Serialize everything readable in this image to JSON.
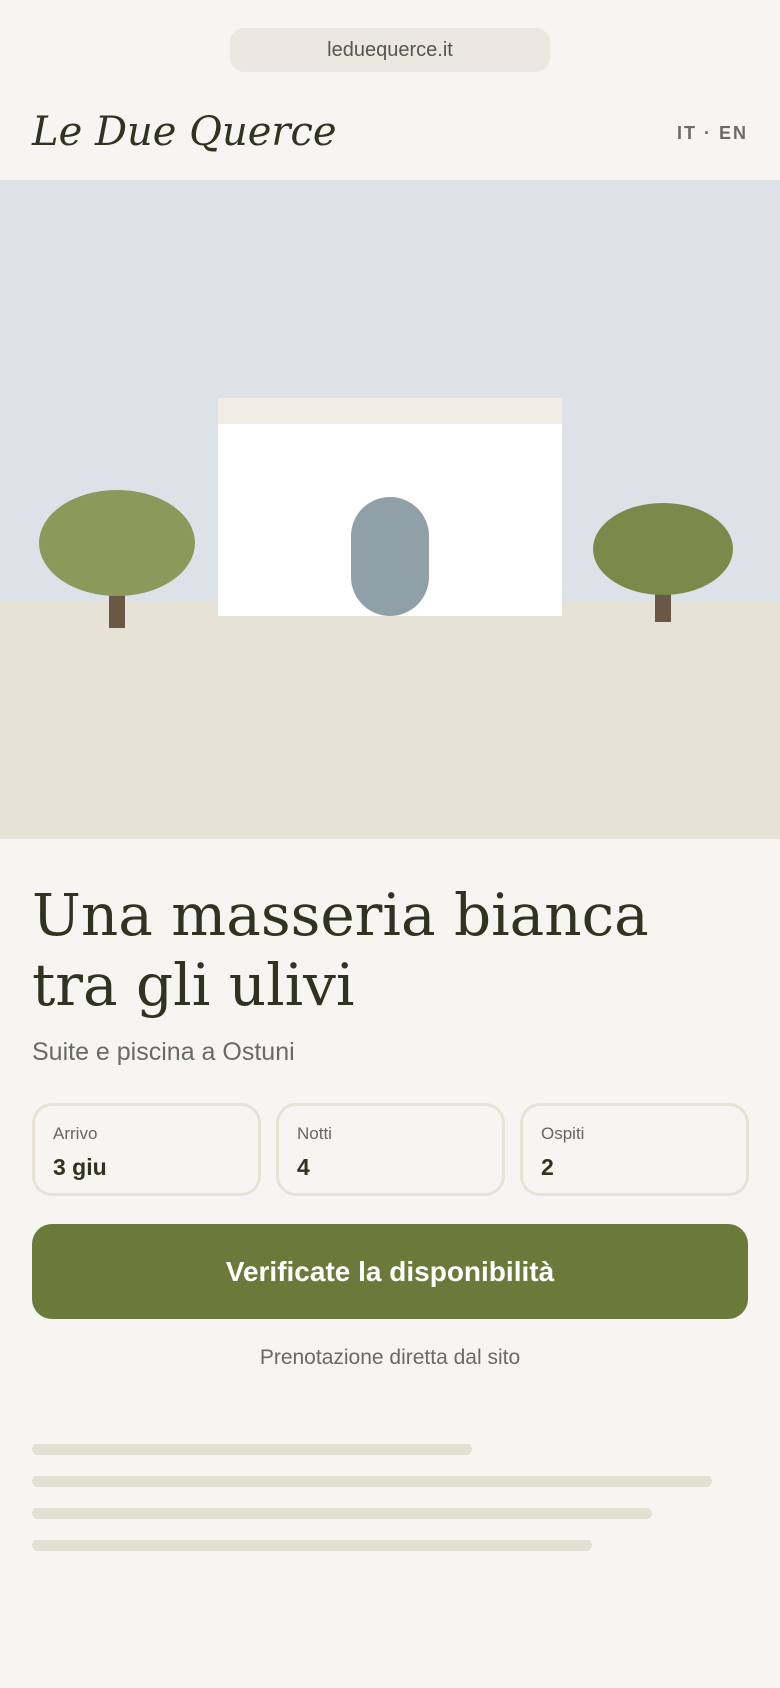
{
  "browser": {
    "url": "leduequerce.it"
  },
  "header": {
    "brand": "Le Due Querce",
    "language_switch": "IT · EN"
  },
  "hero": {
    "scene": "masseria-illustration",
    "colors": {
      "sky": "#dde2e8",
      "ground": "#e6e2d6",
      "house": "#ffffff",
      "door": "#8fa0a7",
      "tree_left": "#8b9a5b",
      "tree_right": "#7a8a4a",
      "trunk": "#6a5744"
    }
  },
  "main": {
    "title_line1": "Una masseria bianca",
    "title_line2": "tra gli ulivi",
    "subtitle": "Suite e piscina a Ostuni"
  },
  "booking": {
    "fields": [
      {
        "label": "Arrivo",
        "value": "3 giu"
      },
      {
        "label": "Notti",
        "value": "4"
      },
      {
        "label": "Ospiti",
        "value": "2"
      }
    ],
    "cta_label": "Verificate la disponibilità",
    "note": "Prenotazione diretta dal sito"
  },
  "theme": {
    "background": "#f6f5f1",
    "accent": "#6b7a3b",
    "text": "#2f3320"
  }
}
